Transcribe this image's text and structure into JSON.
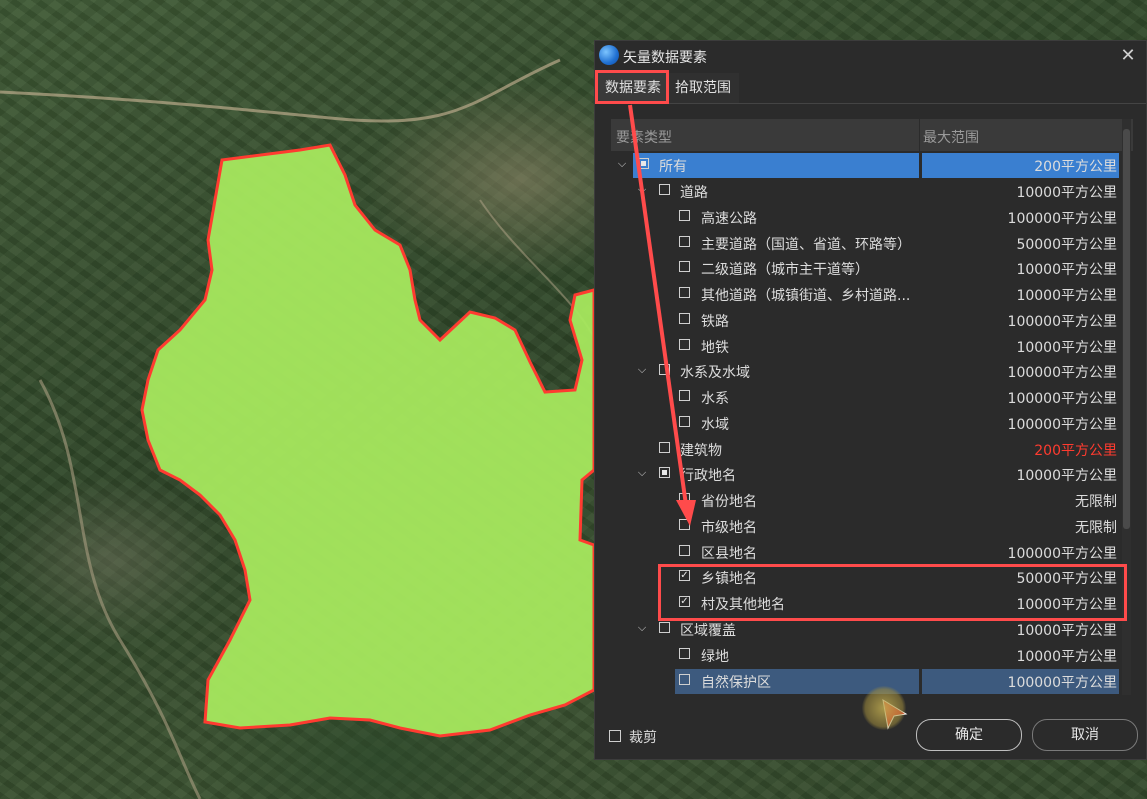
{
  "dialog": {
    "title": "矢量数据要素",
    "tabs": [
      {
        "label": "数据要素"
      },
      {
        "label": "拾取范围"
      }
    ],
    "columns": {
      "type": "要素类型",
      "range": "最大范围"
    },
    "rows": [
      {
        "label": "所有",
        "range": "200平方公里"
      },
      {
        "label": "道路",
        "range": "10000平方公里"
      },
      {
        "label": "高速公路",
        "range": "100000平方公里"
      },
      {
        "label": "主要道路（国道、省道、环路等）",
        "range": "50000平方公里"
      },
      {
        "label": "二级道路（城市主干道等）",
        "range": "10000平方公里"
      },
      {
        "label": "其他道路（城镇街道、乡村道路...",
        "range": "10000平方公里"
      },
      {
        "label": "铁路",
        "range": "100000平方公里"
      },
      {
        "label": "地铁",
        "range": "10000平方公里"
      },
      {
        "label": "水系及水域",
        "range": "100000平方公里"
      },
      {
        "label": "水系",
        "range": "100000平方公里"
      },
      {
        "label": "水域",
        "range": "100000平方公里"
      },
      {
        "label": "建筑物",
        "range": "200平方公里"
      },
      {
        "label": "行政地名",
        "range": "10000平方公里"
      },
      {
        "label": "省份地名",
        "range": "无限制"
      },
      {
        "label": "市级地名",
        "range": "无限制"
      },
      {
        "label": "区县地名",
        "range": "100000平方公里"
      },
      {
        "label": "乡镇地名",
        "range": "50000平方公里"
      },
      {
        "label": "村及其他地名",
        "range": "10000平方公里"
      },
      {
        "label": "区域覆盖",
        "range": "10000平方公里"
      },
      {
        "label": "绿地",
        "range": "10000平方公里"
      },
      {
        "label": "自然保护区",
        "range": "100000平方公里"
      }
    ],
    "footer": {
      "crop_label": "裁剪",
      "ok_label": "确定",
      "cancel_label": "取消"
    },
    "close_glyph": "✕",
    "chevron_glyph": "⌵",
    "check_glyph": "✓"
  },
  "colors": {
    "region_fill": "#a6e85e",
    "region_stroke": "#ff3b30",
    "highlight": "#ff4b4b",
    "selection": "#3a7fd0",
    "warning_text": "#ff3b2f"
  }
}
